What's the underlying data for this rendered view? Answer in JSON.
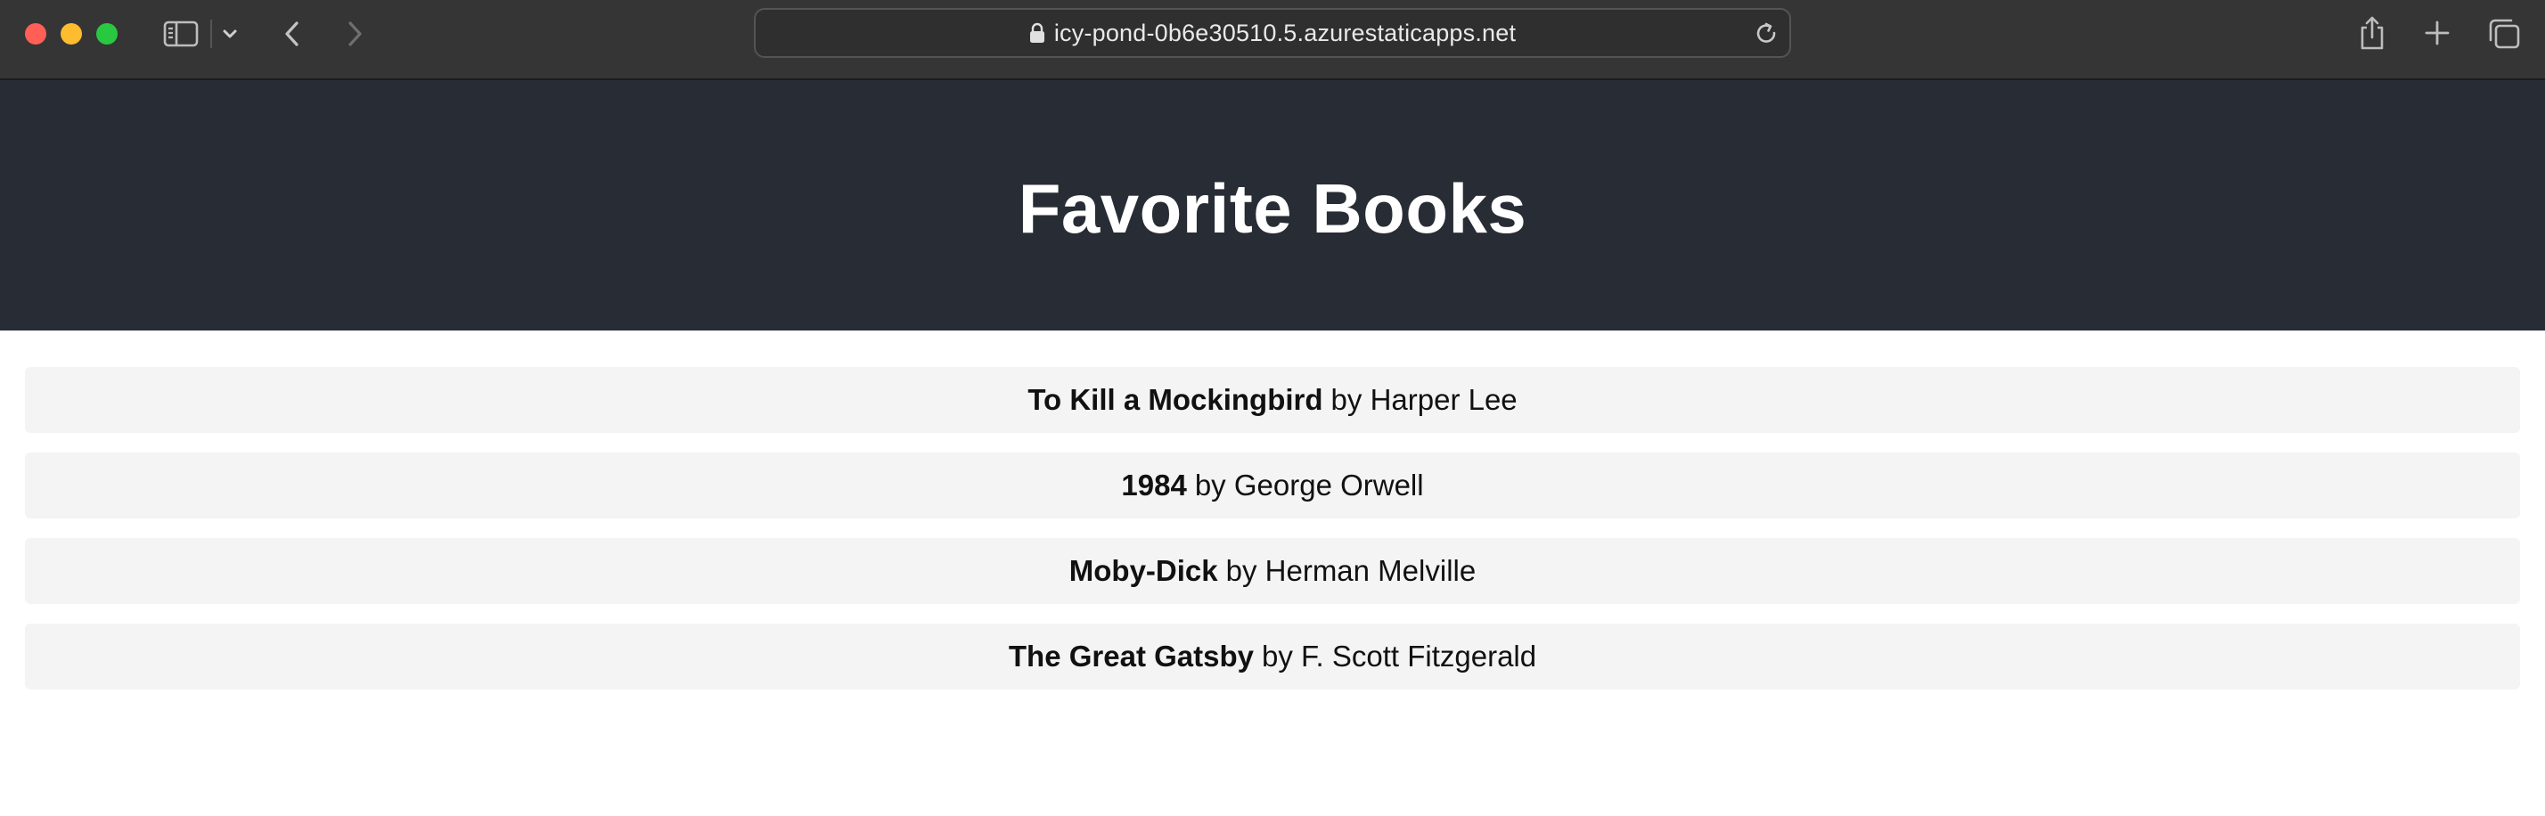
{
  "browser": {
    "url": "icy-pond-0b6e30510.5.azurestaticapps.net"
  },
  "page": {
    "title": "Favorite Books",
    "books": [
      {
        "title": "To Kill a Mockingbird",
        "byline": "by Harper Lee"
      },
      {
        "title": "1984",
        "byline": "by George Orwell"
      },
      {
        "title": "Moby-Dick",
        "byline": "by Herman Melville"
      },
      {
        "title": "The Great Gatsby",
        "byline": "by F. Scott Fitzgerald"
      }
    ]
  },
  "colors": {
    "header_bg": "#282c34",
    "item_bg": "#f4f4f4",
    "chrome_bg": "#353535"
  },
  "icons": [
    "sidebar-icon",
    "chevron-down-icon",
    "back-arrow-icon",
    "forward-arrow-icon",
    "lock-icon",
    "reload-icon",
    "share-icon",
    "plus-icon",
    "tabs-overview-icon"
  ]
}
